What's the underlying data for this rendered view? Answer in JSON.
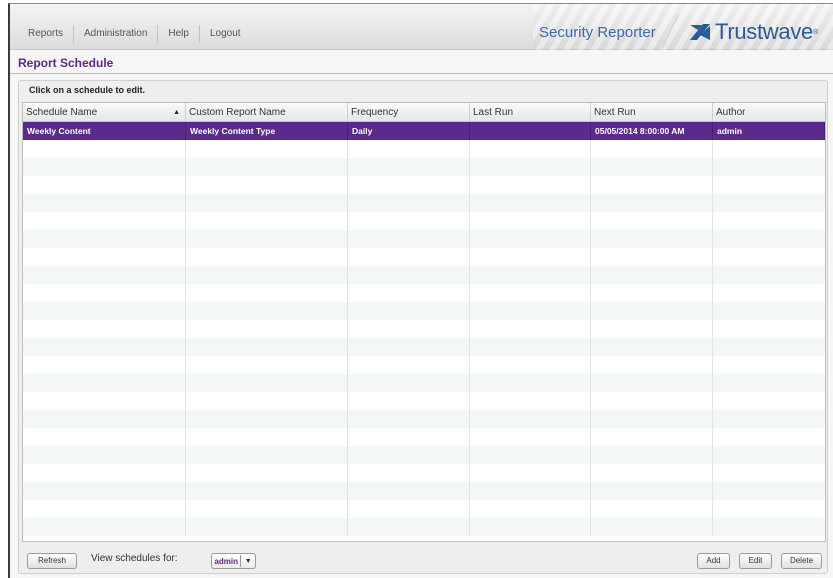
{
  "nav": {
    "items": [
      {
        "label": "Reports"
      },
      {
        "label": "Administration"
      },
      {
        "label": "Help"
      },
      {
        "label": "Logout"
      }
    ]
  },
  "brand": {
    "product": "Security Reporter",
    "logo_text": "Trustwave",
    "reg_mark": "®",
    "logo_color": "#2a5a98"
  },
  "page": {
    "title": "Report Schedule",
    "instruction": "Click on a schedule to edit."
  },
  "grid": {
    "columns": [
      {
        "label": "Schedule Name",
        "sorted": "ascending",
        "sort_glyph": "▲"
      },
      {
        "label": "Custom Report Name"
      },
      {
        "label": "Frequency"
      },
      {
        "label": "Last Run"
      },
      {
        "label": "Next Run"
      },
      {
        "label": "Author"
      }
    ],
    "rows": [
      {
        "selected": true,
        "schedule_name": "Weekly Content",
        "custom_report_name": "Weekly Content Type",
        "frequency": "Daily",
        "last_run": "",
        "next_run": "05/05/2014 8:00:00 AM",
        "author": "admin"
      }
    ],
    "selected_row_color": "#5b2a8a"
  },
  "footer": {
    "refresh_label": "Refresh",
    "view_for_label": "View schedules for:",
    "view_for_value": "admin",
    "dropdown_glyph": "▼",
    "add_label": "Add",
    "edit_label": "Edit",
    "delete_label": "Delete"
  }
}
